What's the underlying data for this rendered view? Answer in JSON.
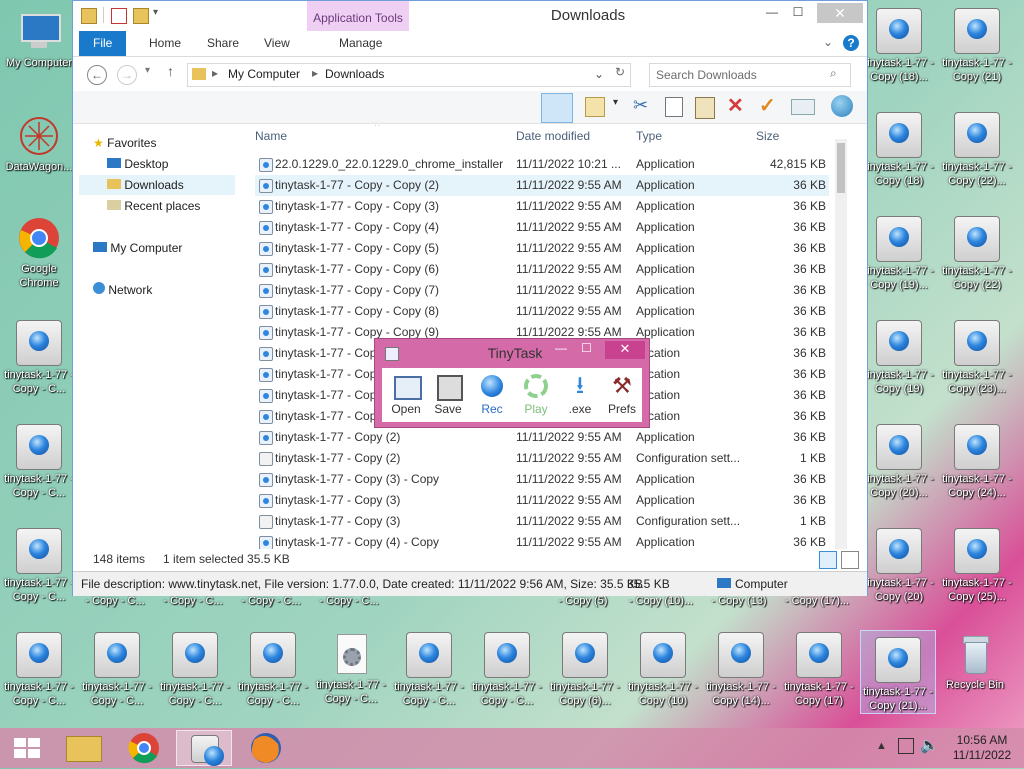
{
  "desktop": {
    "left_icons": [
      {
        "label": "My Computer",
        "kind": "computer"
      },
      {
        "label": "DataWagon...",
        "kind": "datawagon"
      },
      {
        "label": "Google Chrome",
        "kind": "chrome"
      },
      {
        "label": "tinytask-1-77 - Copy - C...",
        "kind": "tt"
      },
      {
        "label": "tinytask-1-77 - Copy - C...",
        "kind": "tt"
      },
      {
        "label": "tinytask-1-77 - Copy - C...",
        "kind": "tt"
      }
    ],
    "right_icons": [
      {
        "label": "tinytask-1-77 - Copy (18)...",
        "kind": "tt"
      },
      {
        "label": "tinytask-1-77 - Copy (21)",
        "kind": "tt"
      },
      {
        "label": "tinytask-1-77 - Copy (18)",
        "kind": "tt"
      },
      {
        "label": "tinytask-1-77 - Copy (22)...",
        "kind": "tt"
      },
      {
        "label": "tinytask-1-77 - Copy (19)...",
        "kind": "tt"
      },
      {
        "label": "tinytask-1-77 - Copy (22)",
        "kind": "tt"
      },
      {
        "label": "tinytask-1-77 - Copy (19)",
        "kind": "tt"
      },
      {
        "label": "tinytask-1-77 - Copy (23)...",
        "kind": "tt"
      },
      {
        "label": "tinytask-1-77 - Copy (20)...",
        "kind": "tt"
      },
      {
        "label": "tinytask-1-77 - Copy (24)...",
        "kind": "tt"
      },
      {
        "label": "tinytask-1-77 - Copy (20)",
        "kind": "tt"
      },
      {
        "label": "tinytask-1-77 - Copy (25)...",
        "kind": "tt"
      }
    ],
    "strip_labels": [
      "- Copy - C...",
      "- Copy - C...",
      "- Copy - C...",
      "- Copy - C...",
      "- Copy (5)",
      "- Copy (10)...",
      "- Copy (13)",
      "- Copy (17)..."
    ],
    "bottom_icons": [
      {
        "label": "tinytask-1-77 - Copy - C...",
        "kind": "tt"
      },
      {
        "label": "tinytask-1-77 - Copy - C...",
        "kind": "tt"
      },
      {
        "label": "tinytask-1-77 - Copy - C...",
        "kind": "tt"
      },
      {
        "label": "tinytask-1-77 - Copy - C...",
        "kind": "tt"
      },
      {
        "label": "tinytask-1-77 - Copy - C...",
        "kind": "cfg"
      },
      {
        "label": "tinytask-1-77 - Copy - C...",
        "kind": "tt"
      },
      {
        "label": "tinytask-1-77 - Copy - C...",
        "kind": "tt"
      },
      {
        "label": "tinytask-1-77 - Copy (6)...",
        "kind": "tt"
      },
      {
        "label": "tinytask-1-77 - Copy (10)",
        "kind": "tt"
      },
      {
        "label": "tinytask-1-77 - Copy (14)...",
        "kind": "tt"
      },
      {
        "label": "tinytask-1-77 - Copy (17)",
        "kind": "tt"
      },
      {
        "label": "tinytask-1-77 - Copy (21)...",
        "kind": "tt"
      },
      {
        "label": "Recycle Bin",
        "kind": "recycle"
      }
    ]
  },
  "explorer": {
    "title": "Downloads",
    "context_tab": "Application Tools",
    "tabs": [
      "File",
      "Home",
      "Share",
      "View",
      "Manage"
    ],
    "breadcrumb": [
      "My Computer",
      "Downloads"
    ],
    "search_placeholder": "Search Downloads",
    "nav": {
      "favorites": "Favorites",
      "desktop": "Desktop",
      "downloads": "Downloads",
      "recent": "Recent places",
      "computer": "My Computer",
      "network": "Network"
    },
    "columns": [
      "Name",
      "Date modified",
      "Type",
      "Size"
    ],
    "rows": [
      {
        "name": "22.0.1229.0_22.0.1229.0_chrome_installer",
        "date": "11/11/2022 10:21 ...",
        "type": "Application",
        "size": "42,815 KB",
        "icon": "inst"
      },
      {
        "name": "tinytask-1-77 - Copy - Copy (2)",
        "date": "11/11/2022 9:55 AM",
        "type": "Application",
        "size": "36 KB",
        "icon": "app",
        "selected": true
      },
      {
        "name": "tinytask-1-77 - Copy - Copy (3)",
        "date": "11/11/2022 9:55 AM",
        "type": "Application",
        "size": "36 KB",
        "icon": "app"
      },
      {
        "name": "tinytask-1-77 - Copy - Copy (4)",
        "date": "11/11/2022 9:55 AM",
        "type": "Application",
        "size": "36 KB",
        "icon": "app"
      },
      {
        "name": "tinytask-1-77 - Copy - Copy (5)",
        "date": "11/11/2022 9:55 AM",
        "type": "Application",
        "size": "36 KB",
        "icon": "app"
      },
      {
        "name": "tinytask-1-77 - Copy - Copy (6)",
        "date": "11/11/2022 9:55 AM",
        "type": "Application",
        "size": "36 KB",
        "icon": "app"
      },
      {
        "name": "tinytask-1-77 - Copy - Copy (7)",
        "date": "11/11/2022 9:55 AM",
        "type": "Application",
        "size": "36 KB",
        "icon": "app"
      },
      {
        "name": "tinytask-1-77 - Copy - Copy (8)",
        "date": "11/11/2022 9:55 AM",
        "type": "Application",
        "size": "36 KB",
        "icon": "app"
      },
      {
        "name": "tinytask-1-77 - Copy - Copy (9)",
        "date": "11/11/2022 9:55 AM",
        "type": "Application",
        "size": "36 KB",
        "icon": "app"
      },
      {
        "name": "tinytask-1-77 - Cop",
        "date": "",
        "type": "plication",
        "size": "36 KB",
        "icon": "app"
      },
      {
        "name": "tinytask-1-77 - Cop",
        "date": "",
        "type": "plication",
        "size": "36 KB",
        "icon": "app"
      },
      {
        "name": "tinytask-1-77 - Cop",
        "date": "",
        "type": "plication",
        "size": "36 KB",
        "icon": "app"
      },
      {
        "name": "tinytask-1-77 - Cop",
        "date": "",
        "type": "plication",
        "size": "36 KB",
        "icon": "app"
      },
      {
        "name": "tinytask-1-77 - Copy (2)",
        "date": "11/11/2022 9:55 AM",
        "type": "Application",
        "size": "36 KB",
        "icon": "app"
      },
      {
        "name": "tinytask-1-77 - Copy (2)",
        "date": "11/11/2022 9:55 AM",
        "type": "Configuration sett...",
        "size": "1 KB",
        "icon": "cfg"
      },
      {
        "name": "tinytask-1-77 - Copy (3) - Copy",
        "date": "11/11/2022 9:55 AM",
        "type": "Application",
        "size": "36 KB",
        "icon": "app"
      },
      {
        "name": "tinytask-1-77 - Copy (3)",
        "date": "11/11/2022 9:55 AM",
        "type": "Application",
        "size": "36 KB",
        "icon": "app"
      },
      {
        "name": "tinytask-1-77 - Copy (3)",
        "date": "11/11/2022 9:55 AM",
        "type": "Configuration sett...",
        "size": "1 KB",
        "icon": "cfg"
      },
      {
        "name": "tinytask-1-77 - Copy (4) - Copy",
        "date": "11/11/2022 9:55 AM",
        "type": "Application",
        "size": "36 KB",
        "icon": "app"
      }
    ],
    "status": {
      "items": "148 items",
      "selected": "1 item selected  35.5 KB"
    },
    "description": "File description: www.tinytask.net, File version: 1.77.0.0, Date created: 11/11/2022 9:56 AM, Size: 35.5 KB",
    "desc_size": "35.5 KB",
    "desc_location": "Computer"
  },
  "tinytask": {
    "title": "TinyTask",
    "buttons": [
      "Open",
      "Save",
      "Rec",
      "Play",
      ".exe",
      "Prefs"
    ]
  },
  "taskbar": {
    "time": "10:56 AM",
    "date": "11/11/2022"
  },
  "colors": {
    "accent": "#1979ca",
    "context_tab": "#e9c8f0",
    "tinytask": "#d46aa8"
  }
}
